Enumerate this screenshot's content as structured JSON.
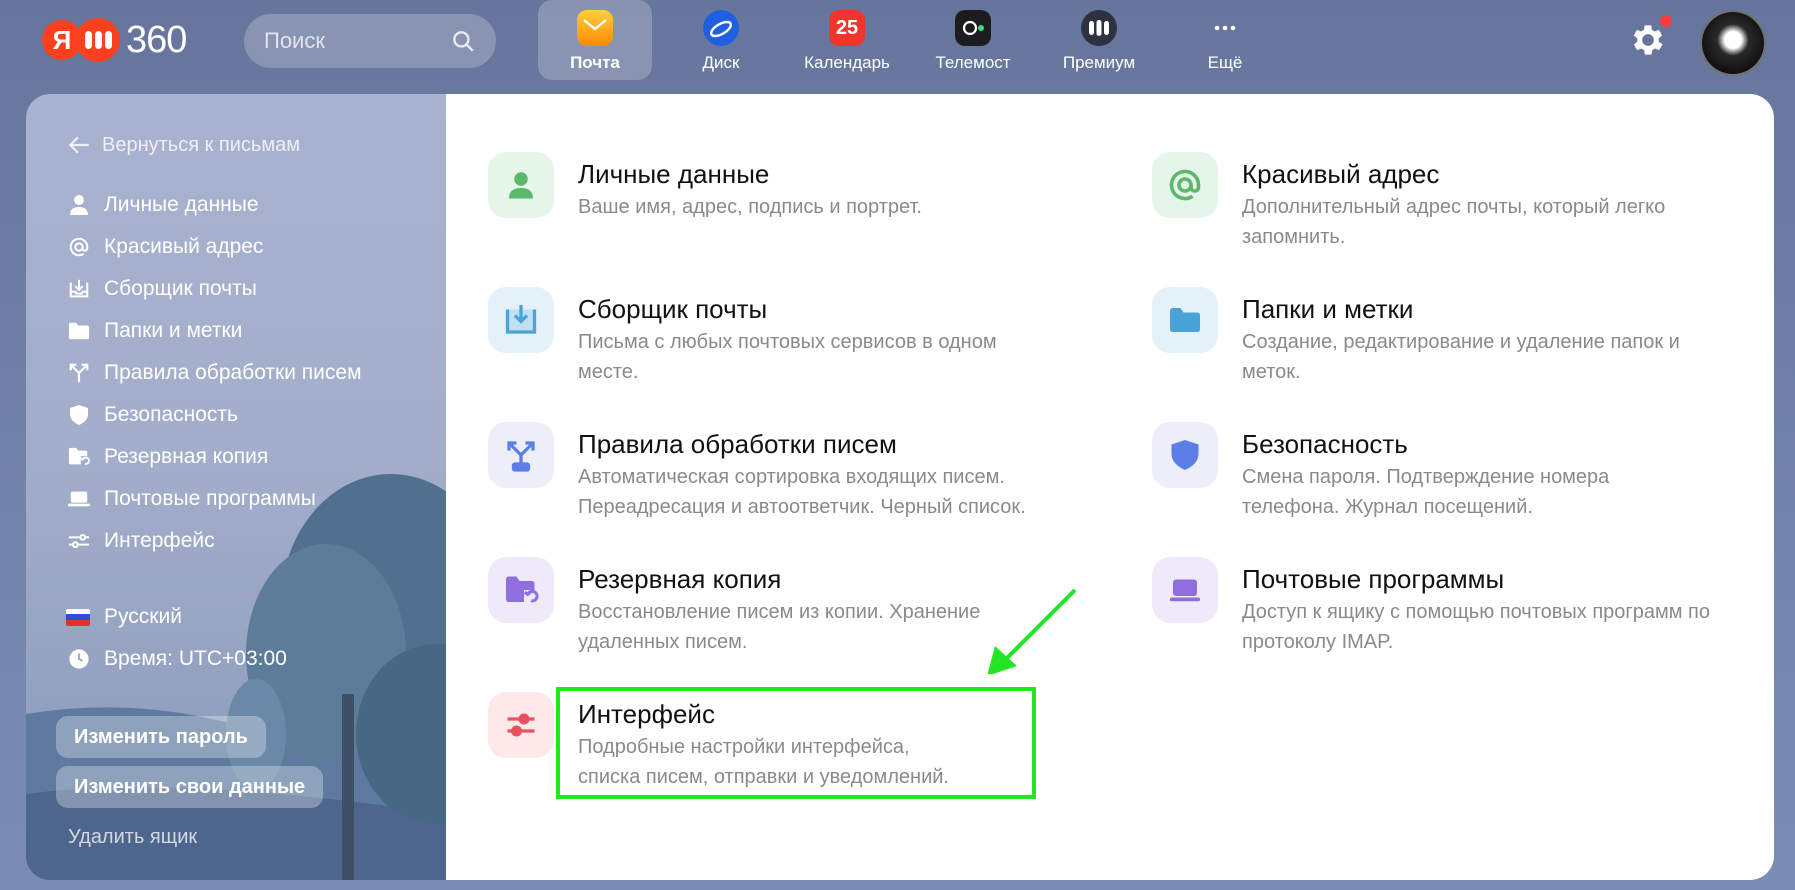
{
  "header": {
    "logo": {
      "letter": "Я",
      "text": "360"
    },
    "search": {
      "placeholder": "Поиск"
    },
    "apps": [
      {
        "label": "Почта",
        "icon": "mail-icon",
        "active": true
      },
      {
        "label": "Диск",
        "icon": "disk-icon"
      },
      {
        "label": "Календарь",
        "icon": "calendar-icon",
        "badge": "25"
      },
      {
        "label": "Телемост",
        "icon": "telemost-icon"
      },
      {
        "label": "Премиум",
        "icon": "premium-icon"
      },
      {
        "label": "Ещё",
        "icon": "more-icon"
      }
    ]
  },
  "sidebar": {
    "back_label": "Вернуться к письмам",
    "items": [
      {
        "label": "Личные данные",
        "icon": "person-icon"
      },
      {
        "label": "Красивый адрес",
        "icon": "at-icon"
      },
      {
        "label": "Сборщик почты",
        "icon": "inbox-download-icon"
      },
      {
        "label": "Папки и метки",
        "icon": "folder-icon"
      },
      {
        "label": "Правила обработки писем",
        "icon": "split-arrows-icon"
      },
      {
        "label": "Безопасность",
        "icon": "shield-icon"
      },
      {
        "label": "Резервная копия",
        "icon": "backup-folder-icon"
      },
      {
        "label": "Почтовые программы",
        "icon": "laptop-icon"
      },
      {
        "label": "Интерфейс",
        "icon": "sliders-icon"
      }
    ],
    "language": "Русский",
    "timezone": "Время: UTC+03:00",
    "change_password": "Изменить пароль",
    "change_data": "Изменить свои данные",
    "delete_mailbox": "Удалить ящик"
  },
  "cards": [
    {
      "title": "Личные данные",
      "desc": "Ваше имя, адрес, подпись и портрет.",
      "icon": "person-icon",
      "color": "#5cb86a"
    },
    {
      "title": "Красивый адрес",
      "desc": "Дополнительный адрес почты, который легко запомнить.",
      "icon": "at-icon",
      "color": "#5cb86a"
    },
    {
      "title": "Сборщик почты",
      "desc": "Письма с любых почтовых сервисов в одном месте.",
      "icon": "inbox-download-icon",
      "color": "#4aa3d8"
    },
    {
      "title": "Папки и метки",
      "desc": "Создание, редактирование и удаление папок и меток.",
      "icon": "folder-icon",
      "color": "#4aa3d8"
    },
    {
      "title": "Правила обработки писем",
      "desc": "Автоматическая сортировка входящих писем. Переадресация и автоответчик. Черный список.",
      "icon": "split-arrows-icon",
      "color": "#5b7fe6"
    },
    {
      "title": "Безопасность",
      "desc": "Смена пароля. Подтверждение номера телефона. Журнал посещений.",
      "icon": "shield-icon",
      "color": "#5b7fe6"
    },
    {
      "title": "Резервная копия",
      "desc": "Восстановление писем из копии. Хранение удаленных писем.",
      "icon": "backup-folder-icon",
      "color": "#8f6fe0"
    },
    {
      "title": "Почтовые программы",
      "desc": "Доступ к ящику с помощью почтовых программ по протоколу IMAP.",
      "icon": "laptop-icon",
      "color": "#8f6fe0"
    },
    {
      "title": "Интерфейс",
      "desc": "Подробные настройки интерфейса, списка писем, отправки и уведомлений.",
      "icon": "sliders-icon",
      "color": "#e8525f"
    }
  ],
  "colors": {
    "accent_highlight": "#22e622",
    "yandex_red": "#fc3f1d"
  }
}
